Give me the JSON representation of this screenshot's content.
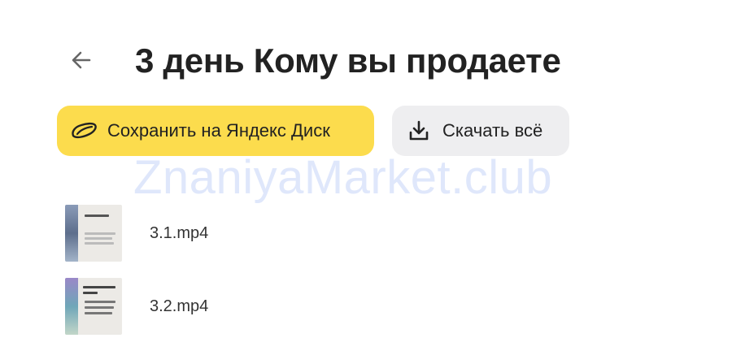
{
  "header": {
    "back_icon": "arrow-left-icon",
    "title": "3 день Кому вы продаете"
  },
  "actions": {
    "save_label": "Сохранить на Яндекс Диск",
    "save_icon": "yandex-disk-icon",
    "download_label": "Скачать всё",
    "download_icon": "download-icon"
  },
  "watermark": "ZnaniyaMarket.club",
  "files": [
    {
      "name": "3.1.mp4",
      "thumbnail_icon": "video-thumbnail"
    },
    {
      "name": "3.2.mp4",
      "thumbnail_icon": "video-thumbnail"
    }
  ],
  "colors": {
    "primary_button": "#fcdc4d",
    "secondary_button": "#eeeef0",
    "watermark": "#dfe7fb",
    "text": "#222222"
  }
}
